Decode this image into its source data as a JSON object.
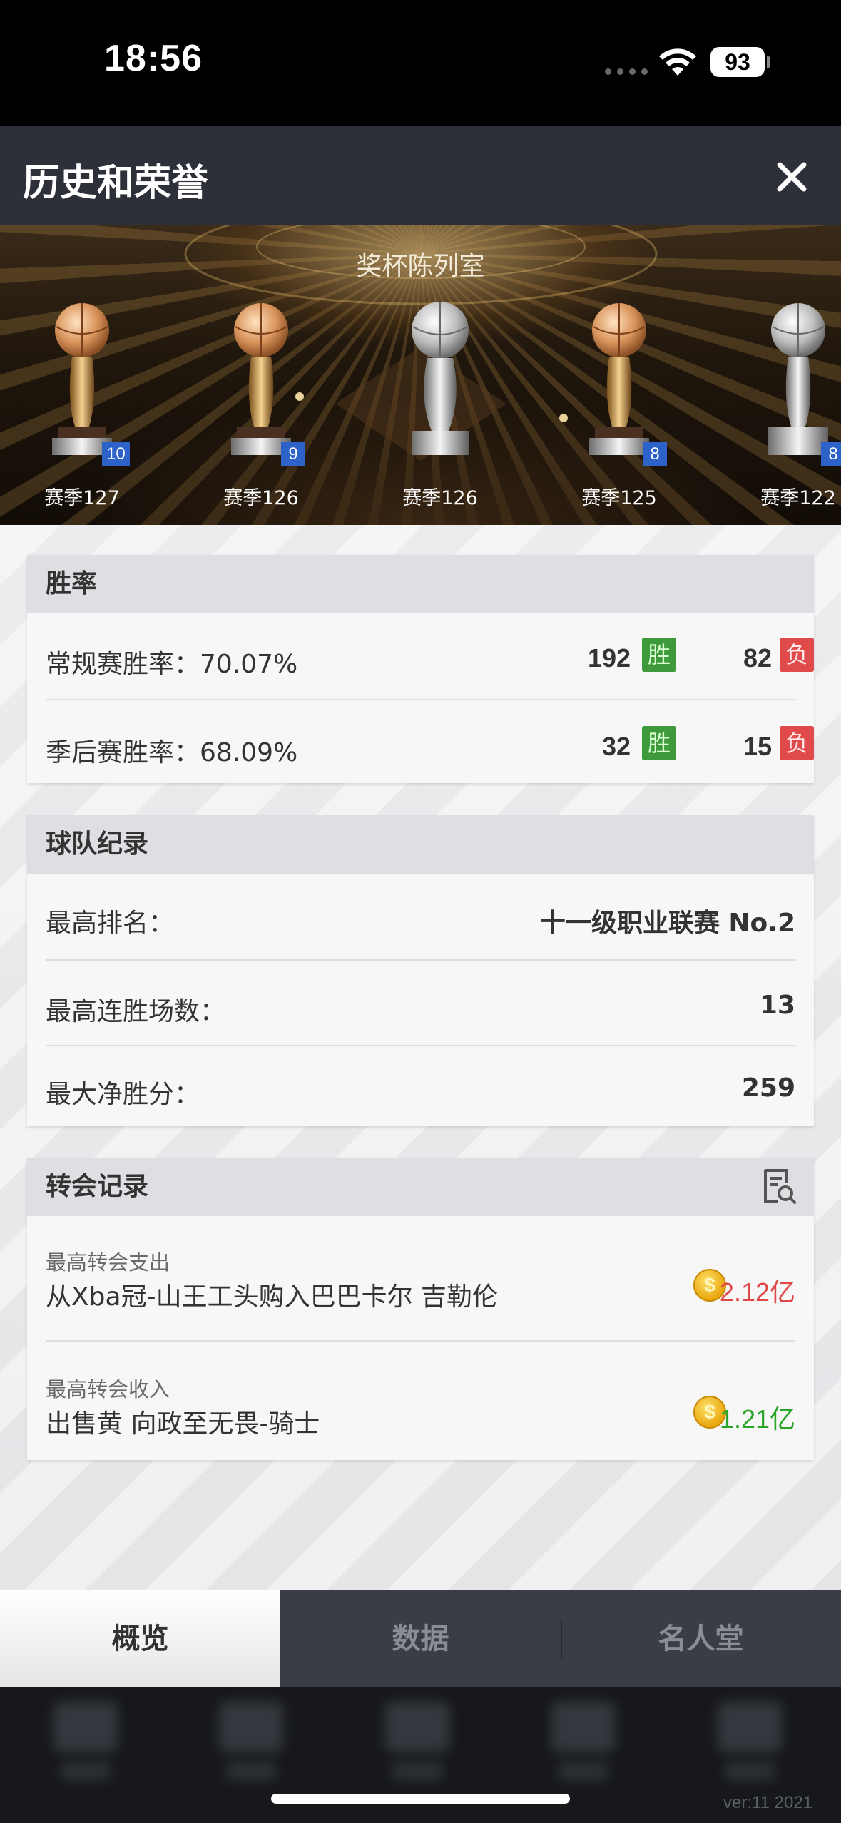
{
  "status_bar": {
    "time": "18:56",
    "battery": "93"
  },
  "header": {
    "title": "历史和荣誉"
  },
  "banner": {
    "title": "奖杯陈列室",
    "trophies": [
      {
        "season": "赛季127",
        "badge": "10"
      },
      {
        "season": "赛季126",
        "badge": "9"
      },
      {
        "season": "赛季126",
        "badge": ""
      },
      {
        "season": "赛季125",
        "badge": "8"
      },
      {
        "season": "赛季122",
        "badge": "8"
      }
    ]
  },
  "win_rate": {
    "title": "胜率",
    "rows": [
      {
        "label": "常规赛胜率：70.07%",
        "wins": "192",
        "win_tag": "胜",
        "losses": "82",
        "loss_tag": "负"
      },
      {
        "label": "季后赛胜率：68.09%",
        "wins": "32",
        "win_tag": "胜",
        "losses": "15",
        "loss_tag": "负"
      }
    ]
  },
  "team_record": {
    "title": "球队纪录",
    "rows": [
      {
        "label": "最高排名：",
        "value": "十一级职业联赛 No.2"
      },
      {
        "label": "最高连胜场数：",
        "value": "13"
      },
      {
        "label": "最大净胜分：",
        "value": "259"
      }
    ]
  },
  "transfer_record": {
    "title": "转会记录",
    "rows": [
      {
        "sub_label": "最高转会支出",
        "text": "从Xba冠-山王工头购入巴巴卡尔 吉勒伦",
        "amount": "2.12亿",
        "amount_color": "#e04848"
      },
      {
        "sub_label": "最高转会收入",
        "text": "出售黄 向政至无畏-骑士",
        "amount": "1.21亿",
        "amount_color": "#2aa52a"
      }
    ]
  },
  "tabs": [
    {
      "label": "概览",
      "active": true
    },
    {
      "label": "数据",
      "active": false
    },
    {
      "label": "名人堂",
      "active": false
    }
  ],
  "footer": {
    "version": "ver:11  2021"
  },
  "colors": {
    "header_bg": "#2d3038",
    "win_green": "#3f9a3c",
    "lose_red": "#e04a4a",
    "badge_blue": "#2d63c8"
  }
}
